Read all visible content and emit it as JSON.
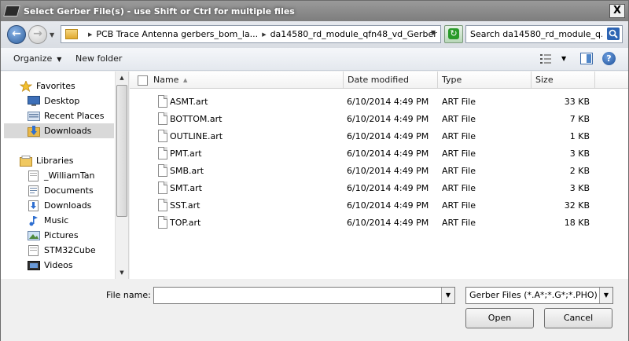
{
  "window": {
    "title": "Select Gerber File(s) - use Shift or Ctrl for multiple files",
    "close_label": "X"
  },
  "address": {
    "segments": [
      "PCB Trace Antenna gerbers_bom_la...",
      "da14580_rd_module_qfn48_vd_Gerber"
    ]
  },
  "search": {
    "placeholder": "Search da14580_rd_module_q..."
  },
  "toolbar": {
    "organize_label": "Organize",
    "new_folder_label": "New folder",
    "help_label": "?"
  },
  "navpane": {
    "favorites_label": "Favorites",
    "favorites": [
      {
        "label": "Desktop",
        "icon": "desktop-icon"
      },
      {
        "label": "Recent Places",
        "icon": "recent-places-icon"
      },
      {
        "label": "Downloads",
        "icon": "downloads-folder-icon",
        "selected": true
      }
    ],
    "libraries_label": "Libraries",
    "libraries": [
      {
        "label": "_WilliamTan",
        "icon": "user-folder-icon"
      },
      {
        "label": "Documents",
        "icon": "documents-icon"
      },
      {
        "label": "Downloads",
        "icon": "downloads-icon"
      },
      {
        "label": "Music",
        "icon": "music-icon"
      },
      {
        "label": "Pictures",
        "icon": "pictures-icon"
      },
      {
        "label": "STM32Cube",
        "icon": "folder-icon"
      },
      {
        "label": "Videos",
        "icon": "videos-icon"
      }
    ]
  },
  "filelist": {
    "columns": {
      "name": "Name",
      "date_modified": "Date modified",
      "type": "Type",
      "size": "Size"
    },
    "rows": [
      {
        "name": "ASMT.art",
        "date": "6/10/2014 4:49 PM",
        "type": "ART File",
        "size": "33 KB"
      },
      {
        "name": "BOTTOM.art",
        "date": "6/10/2014 4:49 PM",
        "type": "ART File",
        "size": "7 KB"
      },
      {
        "name": "OUTLINE.art",
        "date": "6/10/2014 4:49 PM",
        "type": "ART File",
        "size": "1 KB"
      },
      {
        "name": "PMT.art",
        "date": "6/10/2014 4:49 PM",
        "type": "ART File",
        "size": "3 KB"
      },
      {
        "name": "SMB.art",
        "date": "6/10/2014 4:49 PM",
        "type": "ART File",
        "size": "2 KB"
      },
      {
        "name": "SMT.art",
        "date": "6/10/2014 4:49 PM",
        "type": "ART File",
        "size": "3 KB"
      },
      {
        "name": "SST.art",
        "date": "6/10/2014 4:49 PM",
        "type": "ART File",
        "size": "32 KB"
      },
      {
        "name": "TOP.art",
        "date": "6/10/2014 4:49 PM",
        "type": "ART File",
        "size": "18 KB"
      }
    ]
  },
  "bottom": {
    "file_name_label": "File name:",
    "file_name_value": "",
    "filter_value": "Gerber Files (*.A*;*.G*;*.PHO)",
    "open_label": "Open",
    "cancel_label": "Cancel"
  }
}
